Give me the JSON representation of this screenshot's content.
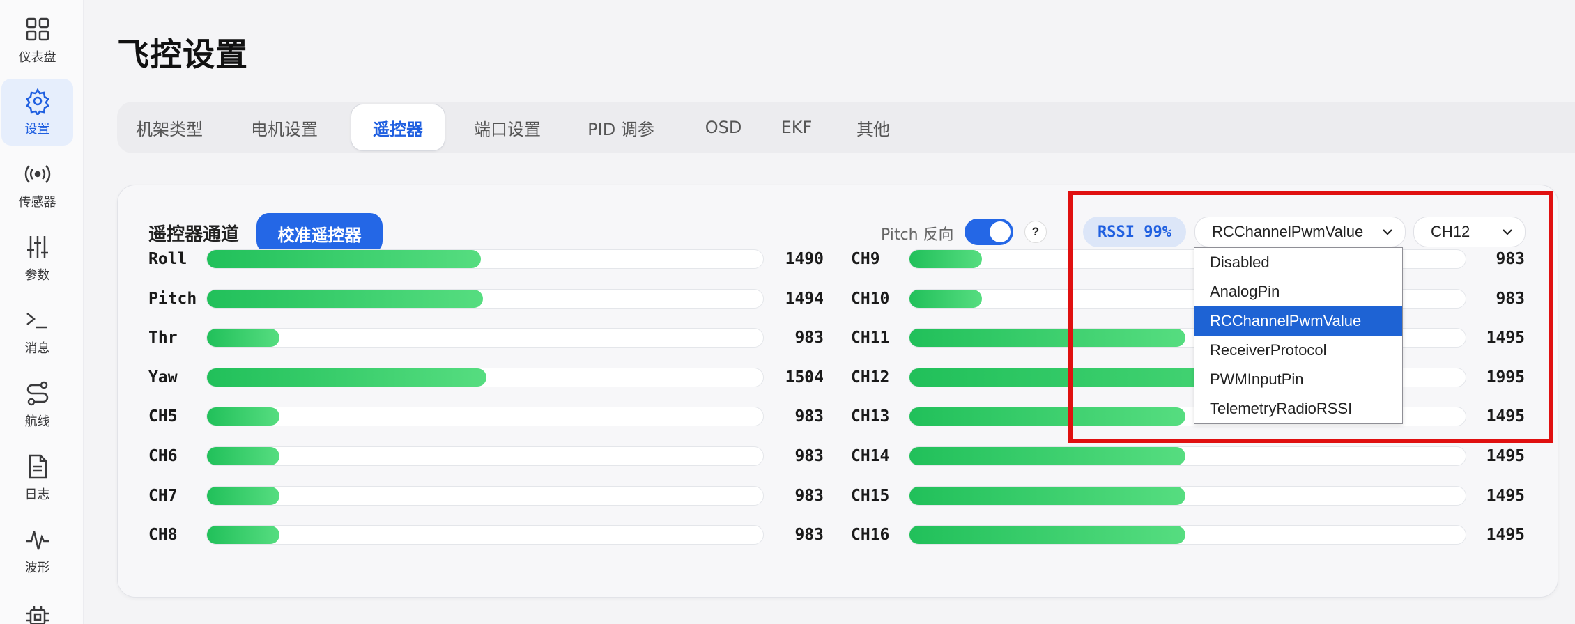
{
  "sidebar": {
    "items": [
      {
        "label": "仪表盘",
        "icon": "dashboard-grid-icon"
      },
      {
        "label": "设置",
        "icon": "gear-icon",
        "active": true
      },
      {
        "label": "传感器",
        "icon": "radio-signal-icon"
      },
      {
        "label": "参数",
        "icon": "sliders-icon"
      },
      {
        "label": "消息",
        "icon": "terminal-prompt-icon"
      },
      {
        "label": "航线",
        "icon": "route-icon"
      },
      {
        "label": "日志",
        "icon": "document-icon"
      },
      {
        "label": "波形",
        "icon": "waveform-icon"
      },
      {
        "label": "",
        "icon": "chip-icon"
      }
    ]
  },
  "page": {
    "title": "飞控设置"
  },
  "tabs": [
    "机架类型",
    "电机设置",
    "遥控器",
    "端口设置",
    "PID 调参",
    "OSD",
    "EKF",
    "其他"
  ],
  "active_tab": "遥控器",
  "card": {
    "title": "遥控器通道",
    "calibrate_button": "校准遥控器",
    "pitch_reverse_label": "Pitch 反向",
    "pitch_reverse_on": true,
    "help": "?",
    "rssi": "RSSI 99%",
    "rssi_source_value": "RCChannelPwmValue",
    "rssi_channel_value": "CH12"
  },
  "channels": {
    "pwm_min": 800,
    "pwm_max": 2200,
    "left": [
      {
        "name": "Roll",
        "value": "1490"
      },
      {
        "name": "Pitch",
        "value": "1494"
      },
      {
        "name": "Thr",
        "value": "983"
      },
      {
        "name": "Yaw",
        "value": "1504"
      },
      {
        "name": "CH5",
        "value": "983"
      },
      {
        "name": "CH6",
        "value": "983"
      },
      {
        "name": "CH7",
        "value": "983"
      },
      {
        "name": "CH8",
        "value": "983"
      }
    ],
    "right": [
      {
        "name": "CH9",
        "value": "983"
      },
      {
        "name": "CH10",
        "value": "983"
      },
      {
        "name": "CH11",
        "value": "1495"
      },
      {
        "name": "CH12",
        "value": "1995"
      },
      {
        "name": "CH13",
        "value": "1495"
      },
      {
        "name": "CH14",
        "value": "1495"
      },
      {
        "name": "CH15",
        "value": "1495"
      },
      {
        "name": "CH16",
        "value": "1495"
      }
    ]
  },
  "dropdown": {
    "options": [
      "Disabled",
      "AnalogPin",
      "RCChannelPwmValue",
      "ReceiverProtocol",
      "PWMInputPin",
      "TelemetryRadioRSSI"
    ],
    "selected": "RCChannelPwmValue"
  },
  "colors": {
    "accent": "#2467e6",
    "bar_green": "#2cc463",
    "highlight_red": "#e01010",
    "dropdown_selected": "#1e63d4"
  }
}
